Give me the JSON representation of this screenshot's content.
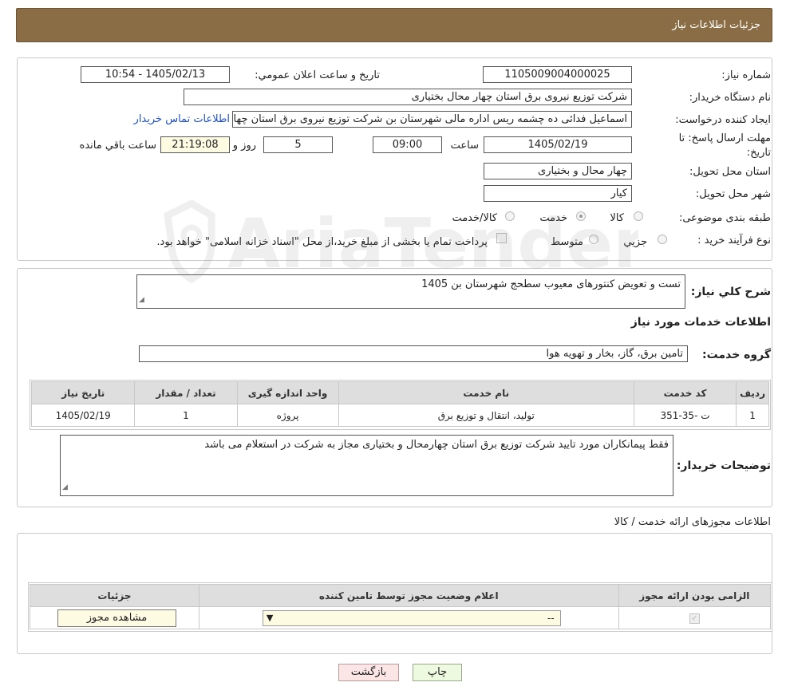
{
  "header": {
    "title": "جزئيات اطلاعات نياز"
  },
  "need": {
    "number_label": "شماره نياز:",
    "number": "1105009004000025",
    "announce_label": "تاريخ و ساعت اعلان عمومي:",
    "announce": "1405/02/13 - 10:54",
    "buyer_label": "نام دستگاه خريدار:",
    "buyer": "شرکت توزیع نیروی برق استان چهار محال بختیاری",
    "creator_label": "ايجاد کننده درخواست:",
    "creator": "اسماعیل فدائی ده چشمه ریس اداره مالی شهرستان بن  شرکت توزیع نیروی برق استان چهار محال بختیاری",
    "contact_link": "اطلاعات تماس خريدار",
    "deadline_label_1": "مهلت ارسال پاسخ: تا",
    "deadline_label_2": "تاريخ:",
    "deadline_date": "1405/02/19",
    "time_label": "ساعت",
    "deadline_time": "09:00",
    "days": "5",
    "days_label": "روز و",
    "remaining": "21:19:08",
    "remaining_label": "ساعت باقي مانده",
    "province_label": "استان محل تحويل:",
    "province": "چهار محال و بختیاری",
    "city_label": "شهر محل تحويل:",
    "city": "کیار",
    "category_label": "طبقه بندی موضوعی:",
    "category_options": [
      "کالا",
      "خدمت",
      "کالا/خدمت"
    ],
    "category_selected": "خدمت",
    "process_label": "نوع فرآیند خرید :",
    "process_options": [
      "جزيي",
      "متوسط"
    ],
    "process_note": "پرداخت تمام يا بخشی از مبلغ خريد،از محل \"اسناد خزانه اسلامی\" خواهد بود."
  },
  "summary": {
    "label": "شرح کلي نياز:",
    "text": "تست و تعویض کنتورهای معیوب سطحج شهرستان بن 1405",
    "services_title": "اطلاعات خدمات مورد نياز",
    "group_label": "گروه خدمت:",
    "group": "تامین برق، گاز، بخار و تهویه هوا",
    "table_headers": [
      "رديف",
      "کد خدمت",
      "نام خدمت",
      "واحد اندازه گيری",
      "تعداد / مقدار",
      "تاريخ نياز"
    ],
    "rows": [
      [
        "1",
        "ت -35-351",
        "تولید، انتقال و توزیع برق",
        "پروژه",
        "1",
        "1405/02/19"
      ]
    ],
    "buyer_notes_label": "توضيحات خريدار:",
    "buyer_notes": "فقط پیمانکاران مورد تایید شرکت توزیع برق استان چهارمحال و بختیاری مجاز به شرکت در استعلام می باشد"
  },
  "permits": {
    "title": "اطلاعات مجوزهای ارائه خدمت / کالا",
    "headers": [
      "الزامی بودن ارائه مجوز",
      "اعلام وضعيت مجوز توسط تامين کننده",
      "جزئيات"
    ],
    "select_value": "--",
    "view_button": "مشاهده مجوز"
  },
  "actions": {
    "print": "چاپ",
    "back": "بازگشت"
  },
  "watermark": "AriaTender.neT"
}
